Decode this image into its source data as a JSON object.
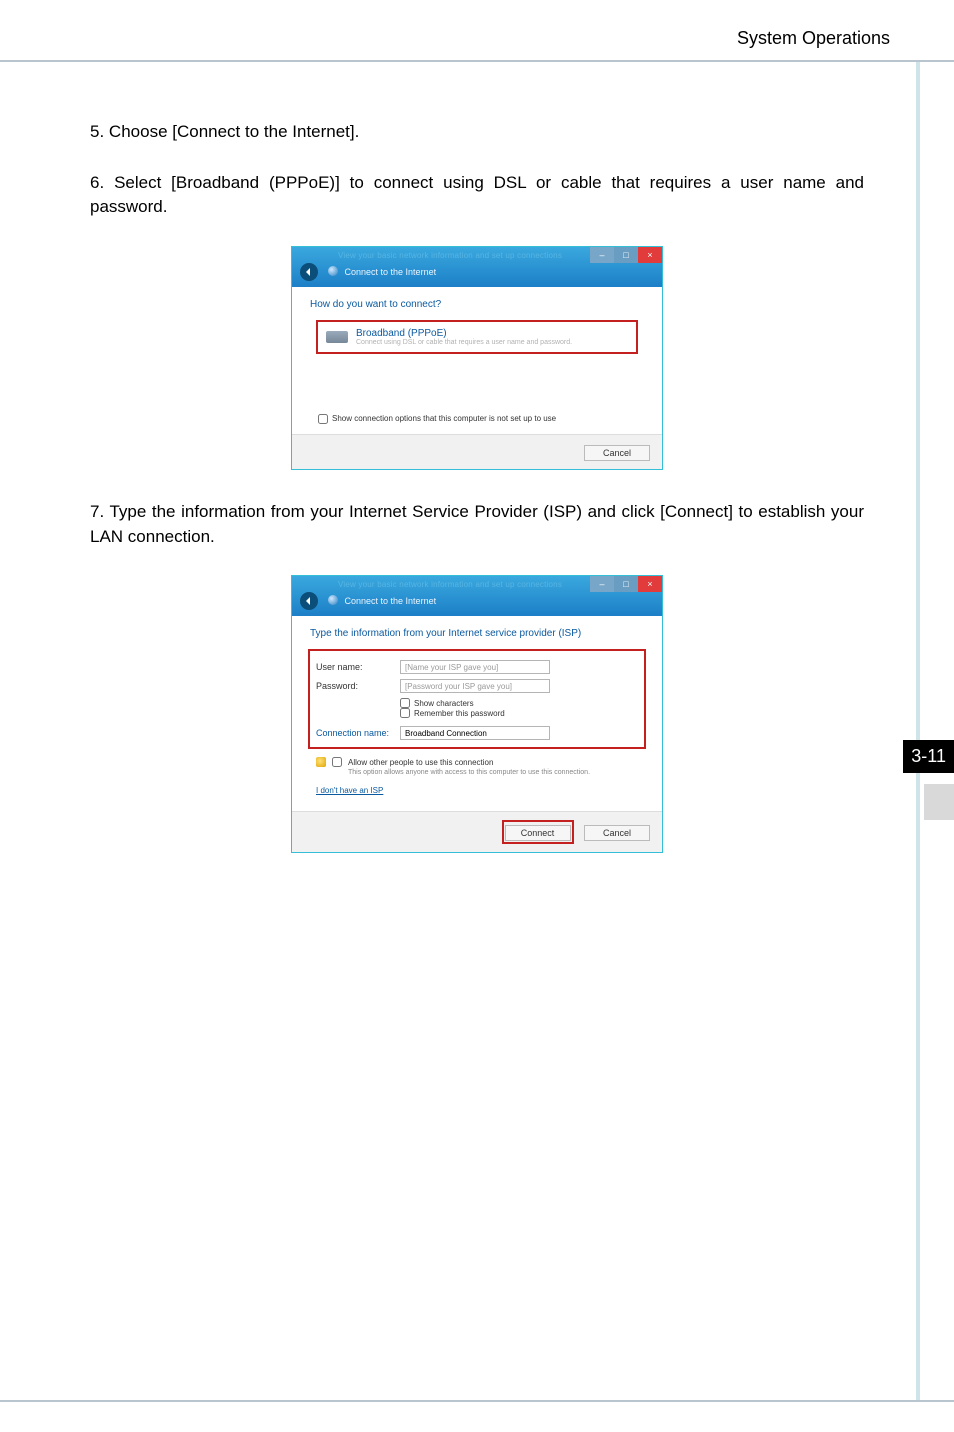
{
  "header": {
    "section": "System Operations"
  },
  "page_number": "3-11",
  "steps": {
    "s5": {
      "num": "5.",
      "text": "Choose [Connect to the Internet]."
    },
    "s6": {
      "num": "6.",
      "text": "Select [Broadband (PPPoE)] to connect using DSL or cable that requires a user name and password."
    },
    "s7": {
      "num": "7.",
      "text": "Type the information from your Internet Service Provider (ISP) and click [Connect] to establish your LAN connection."
    }
  },
  "dlg1": {
    "titlebar_blur": "View your basic network information and set up connections",
    "title": "Connect to the Internet",
    "question": "How do you want to connect?",
    "option_title": "Broadband (PPPoE)",
    "option_sub": "Connect using DSL or cable that requires a user name and password.",
    "show_other": "Show connection options that this computer is not set up to use",
    "cancel": "Cancel"
  },
  "dlg2": {
    "titlebar_blur": "View your basic network information and set up connections",
    "title": "Connect to the Internet",
    "heading": "Type the information from your Internet service provider (ISP)",
    "username_label": "User name:",
    "username_placeholder": "[Name your ISP gave you]",
    "password_label": "Password:",
    "password_placeholder": "[Password your ISP gave you]",
    "show_chars": "Show characters",
    "remember": "Remember this password",
    "conn_label": "Connection name:",
    "conn_value": "Broadband Connection",
    "allow_label": "Allow other people to use this connection",
    "allow_desc": "This option allows anyone with access to this computer to use this connection.",
    "no_isp": "I don't have an ISP",
    "connect": "Connect",
    "cancel": "Cancel"
  }
}
